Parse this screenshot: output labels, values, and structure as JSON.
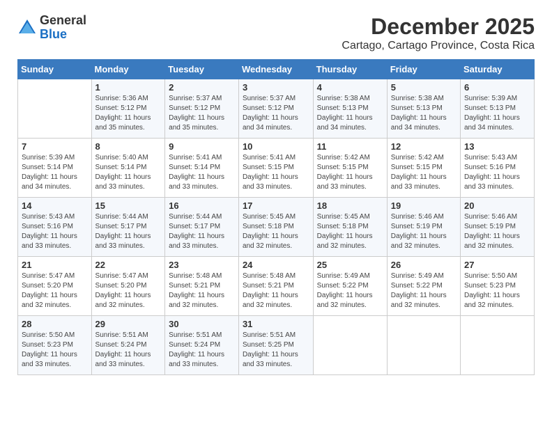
{
  "header": {
    "logo_general": "General",
    "logo_blue": "Blue",
    "month": "December 2025",
    "location": "Cartago, Cartago Province, Costa Rica"
  },
  "calendar": {
    "days_of_week": [
      "Sunday",
      "Monday",
      "Tuesday",
      "Wednesday",
      "Thursday",
      "Friday",
      "Saturday"
    ],
    "weeks": [
      [
        {
          "day": "",
          "info": ""
        },
        {
          "day": "1",
          "info": "Sunrise: 5:36 AM\nSunset: 5:12 PM\nDaylight: 11 hours\nand 35 minutes."
        },
        {
          "day": "2",
          "info": "Sunrise: 5:37 AM\nSunset: 5:12 PM\nDaylight: 11 hours\nand 35 minutes."
        },
        {
          "day": "3",
          "info": "Sunrise: 5:37 AM\nSunset: 5:12 PM\nDaylight: 11 hours\nand 34 minutes."
        },
        {
          "day": "4",
          "info": "Sunrise: 5:38 AM\nSunset: 5:13 PM\nDaylight: 11 hours\nand 34 minutes."
        },
        {
          "day": "5",
          "info": "Sunrise: 5:38 AM\nSunset: 5:13 PM\nDaylight: 11 hours\nand 34 minutes."
        },
        {
          "day": "6",
          "info": "Sunrise: 5:39 AM\nSunset: 5:13 PM\nDaylight: 11 hours\nand 34 minutes."
        }
      ],
      [
        {
          "day": "7",
          "info": "Sunrise: 5:39 AM\nSunset: 5:14 PM\nDaylight: 11 hours\nand 34 minutes."
        },
        {
          "day": "8",
          "info": "Sunrise: 5:40 AM\nSunset: 5:14 PM\nDaylight: 11 hours\nand 33 minutes."
        },
        {
          "day": "9",
          "info": "Sunrise: 5:41 AM\nSunset: 5:14 PM\nDaylight: 11 hours\nand 33 minutes."
        },
        {
          "day": "10",
          "info": "Sunrise: 5:41 AM\nSunset: 5:15 PM\nDaylight: 11 hours\nand 33 minutes."
        },
        {
          "day": "11",
          "info": "Sunrise: 5:42 AM\nSunset: 5:15 PM\nDaylight: 11 hours\nand 33 minutes."
        },
        {
          "day": "12",
          "info": "Sunrise: 5:42 AM\nSunset: 5:15 PM\nDaylight: 11 hours\nand 33 minutes."
        },
        {
          "day": "13",
          "info": "Sunrise: 5:43 AM\nSunset: 5:16 PM\nDaylight: 11 hours\nand 33 minutes."
        }
      ],
      [
        {
          "day": "14",
          "info": "Sunrise: 5:43 AM\nSunset: 5:16 PM\nDaylight: 11 hours\nand 33 minutes."
        },
        {
          "day": "15",
          "info": "Sunrise: 5:44 AM\nSunset: 5:17 PM\nDaylight: 11 hours\nand 33 minutes."
        },
        {
          "day": "16",
          "info": "Sunrise: 5:44 AM\nSunset: 5:17 PM\nDaylight: 11 hours\nand 33 minutes."
        },
        {
          "day": "17",
          "info": "Sunrise: 5:45 AM\nSunset: 5:18 PM\nDaylight: 11 hours\nand 32 minutes."
        },
        {
          "day": "18",
          "info": "Sunrise: 5:45 AM\nSunset: 5:18 PM\nDaylight: 11 hours\nand 32 minutes."
        },
        {
          "day": "19",
          "info": "Sunrise: 5:46 AM\nSunset: 5:19 PM\nDaylight: 11 hours\nand 32 minutes."
        },
        {
          "day": "20",
          "info": "Sunrise: 5:46 AM\nSunset: 5:19 PM\nDaylight: 11 hours\nand 32 minutes."
        }
      ],
      [
        {
          "day": "21",
          "info": "Sunrise: 5:47 AM\nSunset: 5:20 PM\nDaylight: 11 hours\nand 32 minutes."
        },
        {
          "day": "22",
          "info": "Sunrise: 5:47 AM\nSunset: 5:20 PM\nDaylight: 11 hours\nand 32 minutes."
        },
        {
          "day": "23",
          "info": "Sunrise: 5:48 AM\nSunset: 5:21 PM\nDaylight: 11 hours\nand 32 minutes."
        },
        {
          "day": "24",
          "info": "Sunrise: 5:48 AM\nSunset: 5:21 PM\nDaylight: 11 hours\nand 32 minutes."
        },
        {
          "day": "25",
          "info": "Sunrise: 5:49 AM\nSunset: 5:22 PM\nDaylight: 11 hours\nand 32 minutes."
        },
        {
          "day": "26",
          "info": "Sunrise: 5:49 AM\nSunset: 5:22 PM\nDaylight: 11 hours\nand 32 minutes."
        },
        {
          "day": "27",
          "info": "Sunrise: 5:50 AM\nSunset: 5:23 PM\nDaylight: 11 hours\nand 32 minutes."
        }
      ],
      [
        {
          "day": "28",
          "info": "Sunrise: 5:50 AM\nSunset: 5:23 PM\nDaylight: 11 hours\nand 33 minutes."
        },
        {
          "day": "29",
          "info": "Sunrise: 5:51 AM\nSunset: 5:24 PM\nDaylight: 11 hours\nand 33 minutes."
        },
        {
          "day": "30",
          "info": "Sunrise: 5:51 AM\nSunset: 5:24 PM\nDaylight: 11 hours\nand 33 minutes."
        },
        {
          "day": "31",
          "info": "Sunrise: 5:51 AM\nSunset: 5:25 PM\nDaylight: 11 hours\nand 33 minutes."
        },
        {
          "day": "",
          "info": ""
        },
        {
          "day": "",
          "info": ""
        },
        {
          "day": "",
          "info": ""
        }
      ]
    ]
  }
}
